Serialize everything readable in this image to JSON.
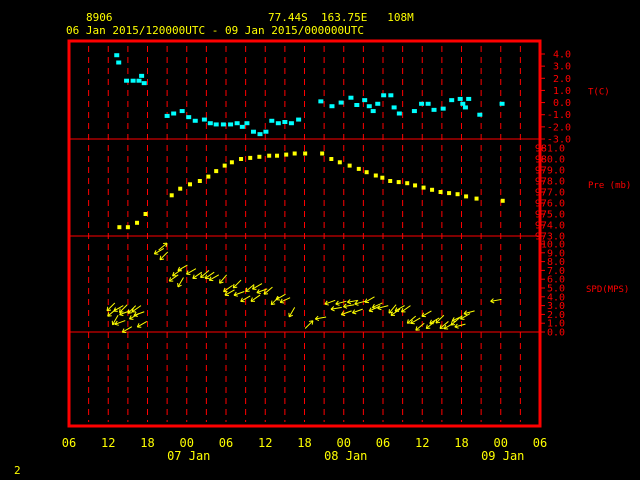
{
  "header": {
    "station": "8906",
    "location": "77.44S  163.75E   108M",
    "period": "06 Jan 2015/120000UTC - 09 Jan 2015/000000UTC"
  },
  "page_number": "2",
  "colors": {
    "frame": "#ff0000",
    "temperature": "#00ffff",
    "pressure": "#ffff00",
    "wind": "#ffff00",
    "text": "#ffff00"
  },
  "chart_data": {
    "type": "scatter",
    "x_unit": "hours since 06 Jan 2015 06 UTC",
    "x_ticks": [
      "06",
      "12",
      "18",
      "00",
      "06",
      "12",
      "18",
      "00",
      "06",
      "12",
      "18",
      "00",
      "06"
    ],
    "date_labels": [
      "07 Jan",
      "08 Jan",
      "09 Jan"
    ],
    "grid": "dashed vertical lines every 3 h",
    "panels": [
      {
        "id": "temperature",
        "label": "T(C)",
        "ylim": [
          -3,
          4
        ],
        "tick_labels": [
          "4.0",
          "3.0",
          "2.0",
          "1.0",
          "0.0",
          "-1.0",
          "-2.0",
          "-3.0"
        ],
        "points": [
          [
            7.3,
            3.9
          ],
          [
            7.6,
            3.3
          ],
          [
            8.8,
            1.8
          ],
          [
            9.8,
            1.8
          ],
          [
            10.7,
            1.8
          ],
          [
            11.1,
            2.2
          ],
          [
            11.5,
            1.6
          ],
          [
            15,
            -1.1
          ],
          [
            16,
            -0.9
          ],
          [
            17.3,
            -0.7
          ],
          [
            18.3,
            -1.2
          ],
          [
            19.3,
            -1.5
          ],
          [
            20.7,
            -1.4
          ],
          [
            21.6,
            -1.7
          ],
          [
            22.5,
            -1.8
          ],
          [
            23.6,
            -1.8
          ],
          [
            24.7,
            -1.8
          ],
          [
            25.7,
            -1.7
          ],
          [
            26.5,
            -2.0
          ],
          [
            27.2,
            -1.7
          ],
          [
            28.2,
            -2.4
          ],
          [
            29.2,
            -2.6
          ],
          [
            30.1,
            -2.4
          ],
          [
            31,
            -1.5
          ],
          [
            32,
            -1.7
          ],
          [
            33,
            -1.6
          ],
          [
            34,
            -1.7
          ],
          [
            35.1,
            -1.4
          ],
          [
            38.5,
            0.1
          ],
          [
            40.2,
            -0.3
          ],
          [
            41.6,
            0.0
          ],
          [
            43.1,
            0.4
          ],
          [
            44,
            -0.2
          ],
          [
            45.2,
            0.2
          ],
          [
            45.9,
            -0.3
          ],
          [
            46.5,
            -0.7
          ],
          [
            47.2,
            -0.1
          ],
          [
            48.1,
            0.6
          ],
          [
            49.2,
            0.6
          ],
          [
            49.7,
            -0.4
          ],
          [
            50.5,
            -0.9
          ],
          [
            52.8,
            -0.7
          ],
          [
            53.9,
            -0.1
          ],
          [
            54.9,
            -0.1
          ],
          [
            55.8,
            -0.6
          ],
          [
            57.2,
            -0.5
          ],
          [
            58.5,
            0.2
          ],
          [
            59.8,
            0.3
          ],
          [
            60.2,
            -0.1
          ],
          [
            60.6,
            -0.4
          ],
          [
            61.1,
            0.3
          ],
          [
            62.8,
            -1.0
          ],
          [
            66.2,
            -0.1
          ]
        ]
      },
      {
        "id": "pressure",
        "label": "Pre (mb)",
        "ylim": [
          973,
          981
        ],
        "tick_labels": [
          "981.0",
          "980.0",
          "979.0",
          "978.0",
          "977.0",
          "976.0",
          "975.0",
          "974.0",
          "973.0"
        ],
        "points": [
          [
            7.7,
            973.8
          ],
          [
            9,
            973.8
          ],
          [
            10.4,
            974.2
          ],
          [
            11.7,
            975.0
          ],
          [
            15.7,
            976.7
          ],
          [
            17,
            977.3
          ],
          [
            18.5,
            977.7
          ],
          [
            20,
            978.0
          ],
          [
            21.3,
            978.4
          ],
          [
            22.5,
            978.9
          ],
          [
            23.8,
            979.4
          ],
          [
            24.9,
            979.7
          ],
          [
            26.3,
            980.0
          ],
          [
            27.7,
            980.1
          ],
          [
            29.1,
            980.2
          ],
          [
            30.6,
            980.3
          ],
          [
            31.8,
            980.3
          ],
          [
            33.2,
            980.4
          ],
          [
            34.5,
            980.5
          ],
          [
            36.1,
            980.5
          ],
          [
            38.7,
            980.5
          ],
          [
            40.1,
            980.0
          ],
          [
            41.4,
            979.7
          ],
          [
            42.9,
            979.4
          ],
          [
            44.3,
            979.1
          ],
          [
            45.5,
            978.8
          ],
          [
            46.9,
            978.5
          ],
          [
            47.9,
            978.3
          ],
          [
            49.1,
            978.0
          ],
          [
            50.4,
            977.9
          ],
          [
            51.7,
            977.8
          ],
          [
            52.9,
            977.6
          ],
          [
            54.2,
            977.4
          ],
          [
            55.5,
            977.2
          ],
          [
            56.8,
            977.0
          ],
          [
            58.1,
            976.9
          ],
          [
            59.4,
            976.8
          ],
          [
            60.7,
            976.6
          ],
          [
            62.3,
            976.4
          ],
          [
            66.3,
            976.2
          ]
        ]
      },
      {
        "id": "wind_speed",
        "label": "SPD(MPS)",
        "ylim": [
          0,
          10
        ],
        "tick_labels": [
          "10.0",
          "9.0",
          "8.0",
          "7.0",
          "6.0",
          "5.0",
          "4.0",
          "3.0",
          "2.0",
          "1.0",
          "0.0"
        ],
        "barbs": [
          [
            7,
            3.3,
            -135
          ],
          [
            7.2,
            2.6,
            -140
          ],
          [
            7.5,
            1.9,
            -120
          ],
          [
            8.3,
            3.0,
            -150
          ],
          [
            8.6,
            1.3,
            -160
          ],
          [
            8.9,
            3.1,
            -135
          ],
          [
            9.3,
            2.4,
            -160
          ],
          [
            9.6,
            0.6,
            -150
          ],
          [
            10.2,
            3.0,
            -135
          ],
          [
            10.7,
            2.1,
            -150
          ],
          [
            11,
            3.0,
            -145
          ],
          [
            11.5,
            2.3,
            -160
          ],
          [
            11.9,
            1.2,
            -150
          ],
          [
            13.7,
            9.3,
            40
          ],
          [
            14.5,
            9.5,
            -150
          ],
          [
            15.1,
            9.1,
            -135
          ],
          [
            16.7,
            6.5,
            -145
          ],
          [
            17.2,
            7.1,
            -145
          ],
          [
            17.5,
            6.2,
            -120
          ],
          [
            18.1,
            7.6,
            -150
          ],
          [
            19.4,
            7.2,
            -150
          ],
          [
            20.3,
            6.8,
            -145
          ],
          [
            21.4,
            7.0,
            -140
          ],
          [
            22.2,
            6.8,
            -145
          ],
          [
            22.9,
            6.5,
            -150
          ],
          [
            24.1,
            6.5,
            -130
          ],
          [
            25,
            5.3,
            -145
          ],
          [
            25.3,
            4.8,
            -150
          ],
          [
            26.3,
            5.9,
            -135
          ],
          [
            26.8,
            4.6,
            -160
          ],
          [
            27.7,
            4.1,
            -150
          ],
          [
            28.3,
            5.4,
            -140
          ],
          [
            29.2,
            4.2,
            -145
          ],
          [
            29.5,
            5.5,
            -150
          ],
          [
            30.3,
            4.9,
            -160
          ],
          [
            31.1,
            5.1,
            -140
          ],
          [
            32.1,
            4.0,
            -135
          ],
          [
            33.1,
            4.3,
            -150
          ],
          [
            33.8,
            3.9,
            -155
          ],
          [
            34.5,
            2.8,
            -120
          ],
          [
            36.1,
            0.4,
            45
          ],
          [
            39.3,
            1.7,
            -170
          ],
          [
            40.7,
            3.6,
            -160
          ],
          [
            41.7,
            2.8,
            -170
          ],
          [
            42.4,
            3.5,
            -165
          ],
          [
            43.2,
            2.4,
            -160
          ],
          [
            43.6,
            3.1,
            -170
          ],
          [
            44.2,
            3.6,
            -170
          ],
          [
            44.9,
            2.6,
            -160
          ],
          [
            45.3,
            3.5,
            -165
          ],
          [
            46.7,
            4.0,
            -150
          ],
          [
            47.4,
            2.9,
            -155
          ],
          [
            47.9,
            3.3,
            -155
          ],
          [
            48.8,
            3.0,
            -165
          ],
          [
            50,
            3.1,
            -130
          ],
          [
            50.6,
            2.6,
            -145
          ],
          [
            51.3,
            3.0,
            -150
          ],
          [
            52.2,
            3.0,
            -145
          ],
          [
            53,
            1.8,
            -140
          ],
          [
            53.7,
            1.6,
            -150
          ],
          [
            54.3,
            1.0,
            -140
          ],
          [
            55.4,
            2.4,
            -150
          ],
          [
            55.9,
            1.2,
            -140
          ],
          [
            56.6,
            1.6,
            -150
          ],
          [
            57.3,
            1.9,
            -135
          ],
          [
            58,
            1.2,
            -140
          ],
          [
            58.8,
            1.0,
            -150
          ],
          [
            59.7,
            1.6,
            -140
          ],
          [
            60.1,
            1.8,
            -155
          ],
          [
            60.6,
            0.9,
            -165
          ],
          [
            61.3,
            2.1,
            -150
          ],
          [
            62,
            2.4,
            -165
          ],
          [
            66.1,
            3.7,
            -170
          ]
        ]
      }
    ]
  }
}
